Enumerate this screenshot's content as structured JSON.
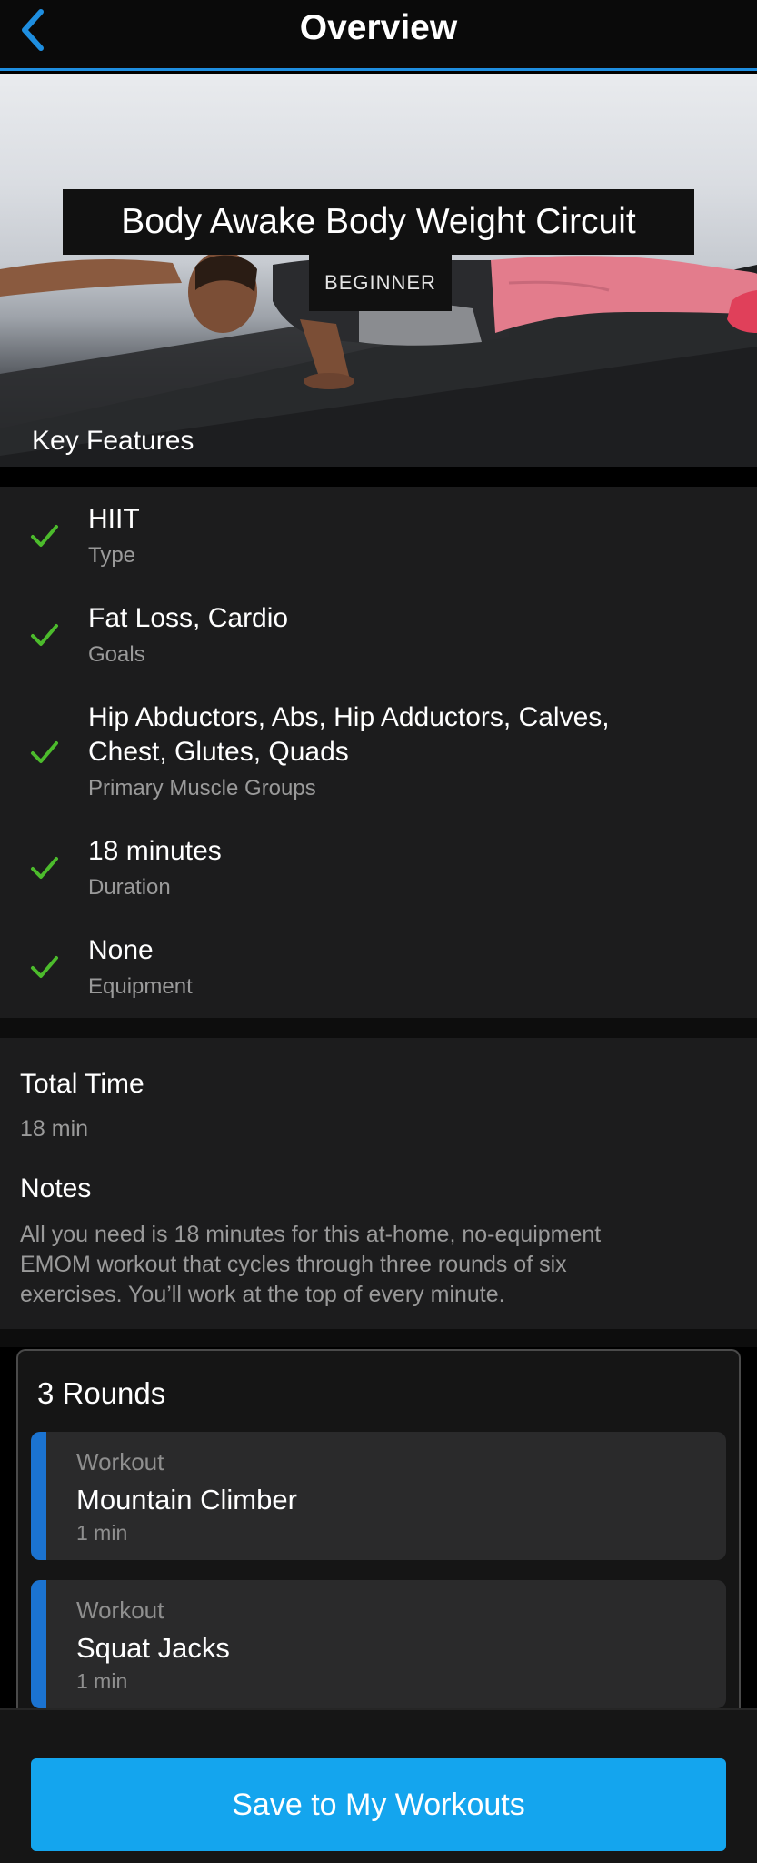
{
  "header": {
    "title": "Overview",
    "back_icon": "chevron-left-icon",
    "accent_color": "#1e8ee0"
  },
  "hero": {
    "title": "Body Awake Body Weight Circuit",
    "level": "BEGINNER",
    "section_label": "Key Features"
  },
  "features": [
    {
      "value": "HIIT",
      "label": "Type",
      "icon": "check-icon"
    },
    {
      "value": "Fat Loss, Cardio",
      "label": "Goals",
      "icon": "check-icon"
    },
    {
      "value_line1": "Hip Abductors, Abs, Hip Adductors, Calves,",
      "value_line2": "Chest, Glutes, Quads",
      "label": "Primary Muscle Groups",
      "icon": "check-icon"
    },
    {
      "value": "18 minutes",
      "label": "Duration",
      "icon": "check-icon"
    },
    {
      "value": "None",
      "label": "Equipment",
      "icon": "check-icon"
    }
  ],
  "info": {
    "total_time_label": "Total Time",
    "total_time_value": "18 min",
    "notes_label": "Notes",
    "notes_lines": [
      "All you need is 18 minutes for this at-home, no-equipment",
      "EMOM workout that cycles through three rounds of six",
      "exercises. You’ll work at the top of every minute."
    ]
  },
  "rounds": {
    "title": "3 Rounds",
    "items": [
      {
        "kind": "Workout",
        "name": "Mountain Climber",
        "duration": "1 min"
      },
      {
        "kind": "Workout",
        "name": "Squat Jacks",
        "duration": "1 min"
      }
    ]
  },
  "actions": {
    "save_label": "Save to My Workouts",
    "button_color": "#14a5ee"
  },
  "colors": {
    "check": "#4cbb2c",
    "card_accent": "#1b73d1"
  }
}
